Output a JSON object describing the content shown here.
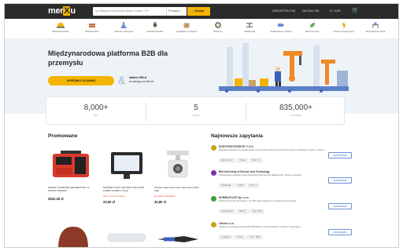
{
  "header": {
    "logo": {
      "pre": "mer",
      "x": "X",
      "post": "u"
    },
    "search_placeholder": "np. kategoria, konstrukcja stalowa, Kraków, \"XX\"",
    "search_scope": "Produkty",
    "search_button": "Szukaj",
    "links": [
      "ZAREJESTRUJ SIĘ",
      "ZALOGUJ SIĘ",
      "PL / EUR"
    ]
  },
  "categories": [
    "Bezpieczeństwo",
    "Budownictwo",
    "Chemia i tworzywa",
    "Elektrotechnika",
    "Logistyka i transport",
    "Maszyny",
    "Metalurgia",
    "Opakowania i etykiety",
    "Ochrona środ.",
    "Przemysł spożywczy",
    "Wyposażenie biura"
  ],
  "hero": {
    "title": "Międzynarodowa platforma B2B dla przemysłu",
    "cta": "WYPRÓBUJ ZA DARMO",
    "bonus_line1": "odbierz 500 zł",
    "bonus_line2": "na zakupy na Merxu!"
  },
  "stats": [
    {
      "value": "8,000+",
      "caption": "Firm"
    },
    {
      "value": "5",
      "caption": "Krajów"
    },
    {
      "value": "835,000+",
      "caption": "Produktów"
    }
  ],
  "promoted": {
    "title": "Promowane",
    "products": [
      {
        "name": "SMART INVERTER GENERATOR 3.0 PORTA PARKER",
        "stock": "",
        "price": "3942,28 zł"
      },
      {
        "name": "NAŚWIETLACZ LED 50W HALOGEN LAMPA CZARNY SLIM",
        "stock": "Ilość: 1 szt. Na stanie",
        "price": "20,50 zł"
      },
      {
        "name": "Oprawa natynkowa spot biała tuba GU10 LED",
        "stock": "Na stanie / Dostępne",
        "price": "30,80 zł"
      }
    ]
  },
  "inquiries": {
    "title": "Najnowsze zapytania",
    "reply_label": "ODPOWIEDZ",
    "items": [
      {
        "company": "ELEKTROSYSTEM SP. Z O.O.",
        "desc": "Zapytanie ofertowe na dostawę kabli i przewodów elektrycznych dla inwestycji w Gdańsku. Prosimy o ofertę.",
        "tags": [
          "Zakupy hurt.",
          "Polska",
          "Ilość: 10"
        ],
        "color": "#c7a21a"
      },
      {
        "company": "Bolt University of Science and Technology",
        "desc": "Poszukujemy dostawcy stali nierdzewnej 304 do prac badawczych. Proszę o kontakt.",
        "tags": [
          "Metalurgia",
          "Polska",
          "Ilość: 5"
        ],
        "color": "#7c2fb3"
      },
      {
        "company": "NORMA-PLAST Sp. z o.o.",
        "desc": "Zakup folii stretch 23 mikrony, ok. 500 rolek miesięcznie. Dostawa do Poznania.",
        "tags": [
          "Opakowania",
          "Niemcy",
          "Ilość: 500"
        ],
        "color": "#3aa33a"
      },
      {
        "company": "Oferteo s.r.o.",
        "desc": "Szukamy producenta palet EUR 1200x800 w dużych ilościach. Oferta z transportem.",
        "tags": [
          "Logistyka",
          "Czechy",
          "Ilość: 1000"
        ],
        "color": "#c7a21a"
      }
    ]
  }
}
